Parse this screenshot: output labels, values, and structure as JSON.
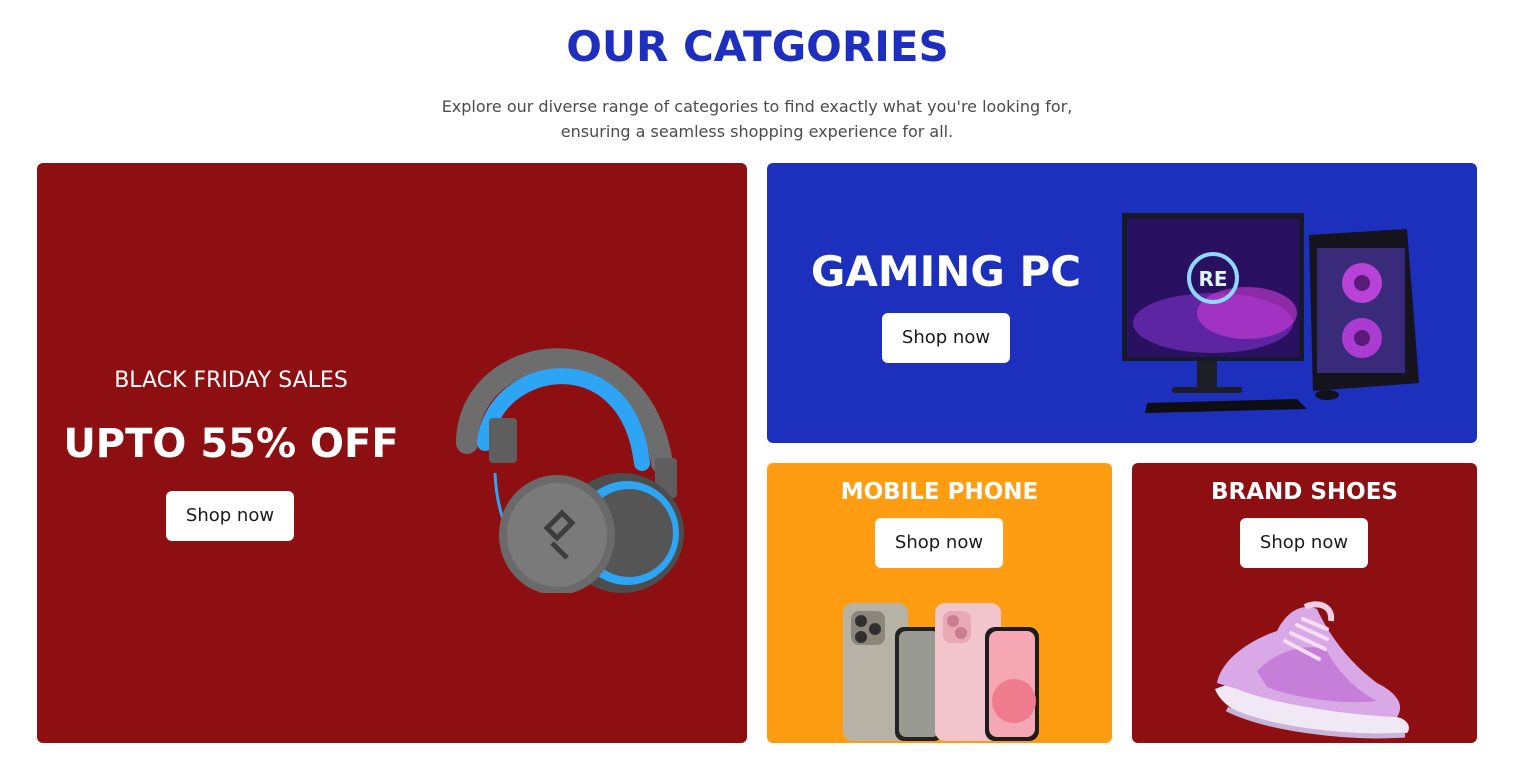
{
  "section": {
    "title": "OUR CATGORIES",
    "subtitle": "Explore our diverse range of categories to find exactly what you're looking for, ensuring a seamless shopping experience for all."
  },
  "cards": {
    "black_friday": {
      "eyebrow": "BLACK FRIDAY SALES",
      "headline": "UPTO 55% OFF",
      "button": "Shop now",
      "image_icon": "headphones-image",
      "color": "#8d0f12"
    },
    "gaming_pc": {
      "title": "GAMING PC",
      "button": "Shop now",
      "image_icon": "gaming-pc-image",
      "color": "#1c2fbd"
    },
    "mobile_phone": {
      "title": "MOBILE PHONE",
      "button": "Shop now",
      "image_icon": "smartphones-image",
      "color": "#ff9d12"
    },
    "brand_shoes": {
      "title": "BRAND SHOES",
      "button": "Shop now",
      "image_icon": "sneaker-image",
      "color": "#8d0f12"
    }
  },
  "colors": {
    "title": "#1e2fbf",
    "subtitle": "#4b4b4b",
    "button_bg": "#ffffff"
  }
}
